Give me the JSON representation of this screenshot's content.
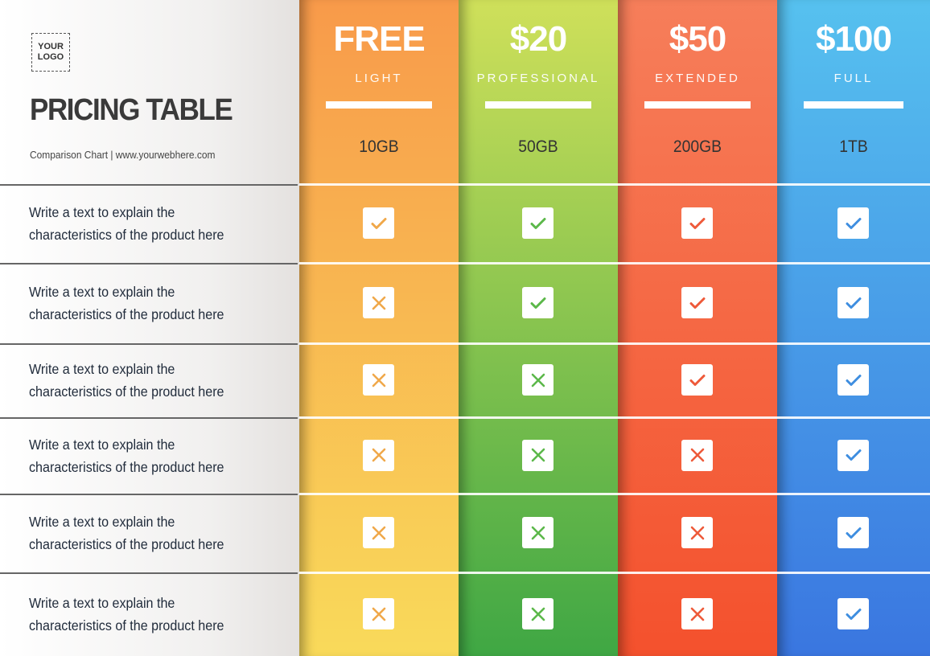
{
  "header": {
    "logo": [
      "YOUR",
      "LOGO"
    ],
    "title": "PRICING TABLE",
    "subtitle": "Comparison Chart | www.yourwebhere.com"
  },
  "features": [
    [
      "Write a text to explain the",
      "characteristics of the product here"
    ],
    [
      "Write a text to explain the",
      "characteristics of the product here"
    ],
    [
      "Write a text to explain the",
      "characteristics of the product here"
    ],
    [
      "Write a text to explain the",
      "characteristics of the product here"
    ],
    [
      "Write a text to explain the",
      "characteristics of the product here"
    ],
    [
      "Write a text to explain the",
      "characteristics of the product here"
    ]
  ],
  "plans": [
    {
      "price": "FREE",
      "tier": "LIGHT",
      "storage": "10GB",
      "color_top": "#f89a4a",
      "color_bottom": "#f9da5a",
      "mark_color": "#f0a84a",
      "included": [
        true,
        false,
        false,
        false,
        false,
        false
      ]
    },
    {
      "price": "$20",
      "tier": "PROFESSIONAL",
      "storage": "50GB",
      "color_top": "#cfe05a",
      "color_bottom": "#3fa744",
      "mark_color": "#5cb84a",
      "included": [
        true,
        true,
        false,
        false,
        false,
        false
      ]
    },
    {
      "price": "$50",
      "tier": "EXTENDED",
      "storage": "200GB",
      "color_top": "#f67e5a",
      "color_bottom": "#f4512d",
      "mark_color": "#ee5a3a",
      "included": [
        true,
        true,
        true,
        false,
        false,
        false
      ]
    },
    {
      "price": "$100",
      "tier": "FULL",
      "storage": "1TB",
      "color_top": "#56c1ef",
      "color_bottom": "#3a76e0",
      "mark_color": "#3f8ee0",
      "included": [
        true,
        true,
        true,
        true,
        true,
        true
      ]
    }
  ]
}
